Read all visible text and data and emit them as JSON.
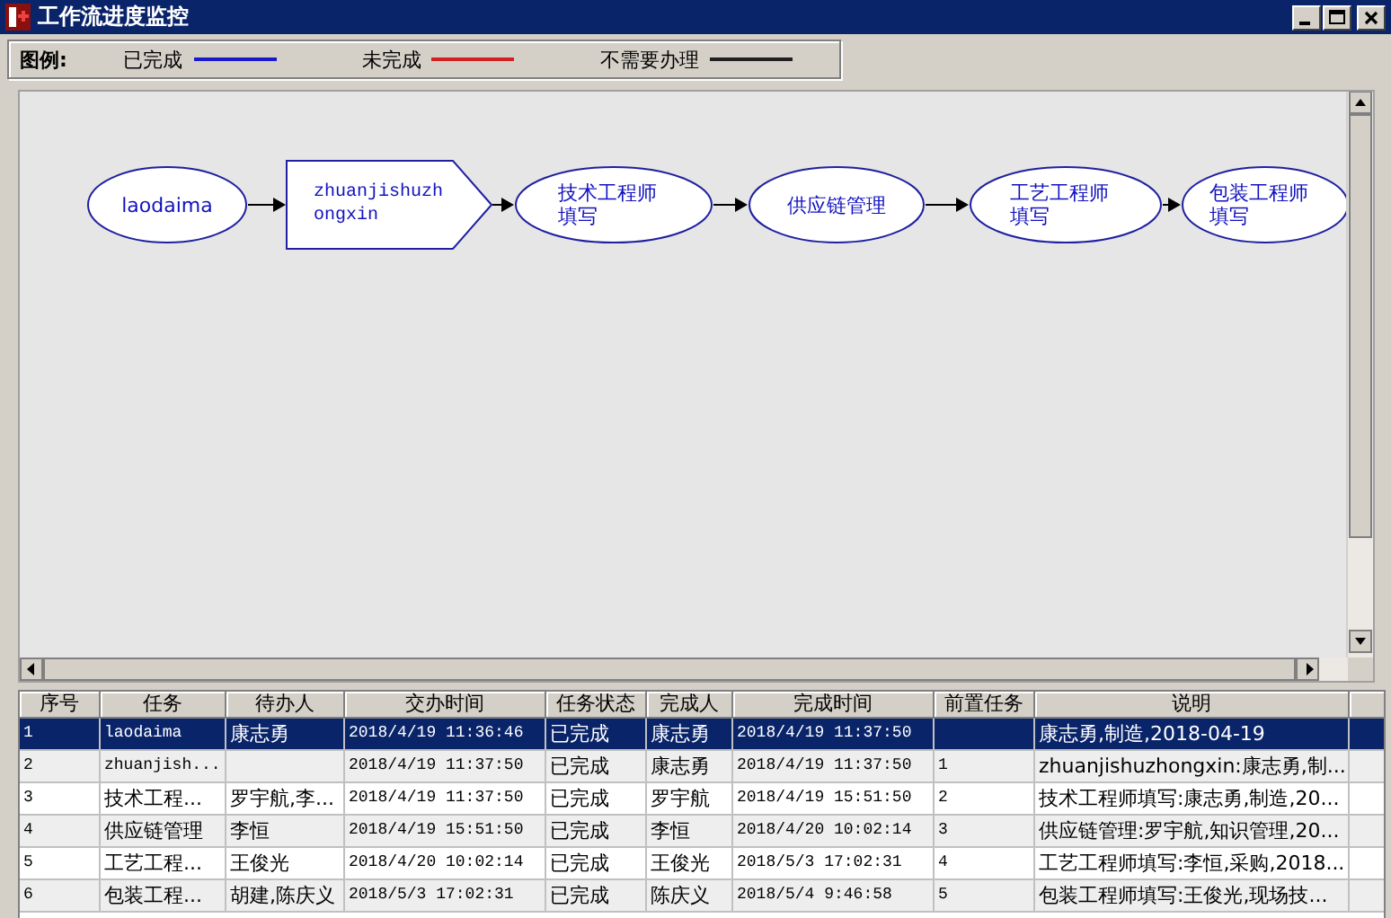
{
  "window": {
    "title": "工作流进度监控"
  },
  "legend": {
    "title": "图例:",
    "items": [
      {
        "label": "已完成",
        "color": "#1a1acc"
      },
      {
        "label": "未完成",
        "color": "#d42020"
      },
      {
        "label": "不需要办理",
        "color": "#202020"
      }
    ]
  },
  "flow": {
    "nodes": [
      {
        "label": "laodaima",
        "kind": "ellipse"
      },
      {
        "label": "zhuanjishuzhongxin",
        "kind": "pentagon"
      },
      {
        "label": "技术工程师填写",
        "kind": "ellipse"
      },
      {
        "label": "供应链管理",
        "kind": "ellipse"
      },
      {
        "label": "工艺工程师填写",
        "kind": "ellipse"
      },
      {
        "label": "包装工程师填写",
        "kind": "ellipse"
      }
    ]
  },
  "table": {
    "columns": [
      "序号",
      "任务",
      "待办人",
      "交办时间",
      "任务状态",
      "完成人",
      "完成时间",
      "前置任务",
      "说明"
    ],
    "rows": [
      {
        "selected": true,
        "cells": [
          "1",
          "laodaima",
          "康志勇",
          "2018/4/19 11:36:46",
          "已完成",
          "康志勇",
          "2018/4/19 11:37:50",
          "",
          "康志勇,制造,2018-04-19"
        ]
      },
      {
        "selected": false,
        "cells": [
          "2",
          "zhuanjish...",
          "",
          "2018/4/19 11:37:50",
          "已完成",
          "康志勇",
          "2018/4/19 11:37:50",
          "1",
          "zhuanjishuzhongxin:康志勇,制..."
        ]
      },
      {
        "selected": false,
        "cells": [
          "3",
          "技术工程...",
          "罗宇航,李...",
          "2018/4/19 11:37:50",
          "已完成",
          "罗宇航",
          "2018/4/19 15:51:50",
          "2",
          "技术工程师填写:康志勇,制造,20..."
        ]
      },
      {
        "selected": false,
        "cells": [
          "4",
          "供应链管理",
          "李恒",
          "2018/4/19 15:51:50",
          "已完成",
          "李恒",
          "2018/4/20 10:02:14",
          "3",
          "供应链管理:罗宇航,知识管理,20..."
        ]
      },
      {
        "selected": false,
        "cells": [
          "5",
          "工艺工程...",
          "王俊光",
          "2018/4/20 10:02:14",
          "已完成",
          "王俊光",
          "2018/5/3 17:02:31",
          "4",
          "工艺工程师填写:李恒,采购,2018..."
        ]
      },
      {
        "selected": false,
        "cells": [
          "6",
          "包装工程...",
          "胡建,陈庆义",
          "2018/5/3 17:02:31",
          "已完成",
          "陈庆义",
          "2018/5/4 9:46:58",
          "5",
          "包装工程师填写:王俊光,现场技..."
        ]
      }
    ]
  }
}
